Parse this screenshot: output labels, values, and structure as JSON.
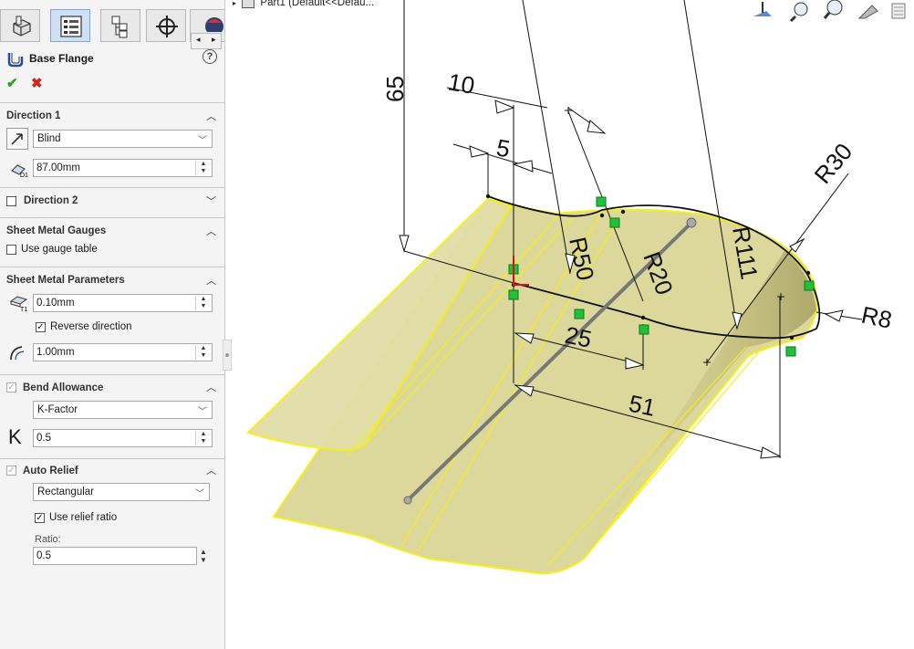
{
  "tabs": [
    {
      "name": "feature-manager",
      "icon": "feature-tree-icon"
    },
    {
      "name": "property-manager",
      "icon": "property-list-icon",
      "active": true
    },
    {
      "name": "configuration-manager",
      "icon": "configuration-icon"
    },
    {
      "name": "dimxpert-manager",
      "icon": "crosshair-icon"
    },
    {
      "name": "display-manager",
      "icon": "appearance-sphere-icon"
    }
  ],
  "feature": {
    "title": "Base Flange",
    "help": "?"
  },
  "direction1": {
    "header": "Direction 1",
    "end_condition": "Blind",
    "depth": "87.00mm"
  },
  "direction2": {
    "header": "Direction 2",
    "checked": false
  },
  "gauges": {
    "header": "Sheet Metal Gauges",
    "use_gauge_table": "Use gauge table"
  },
  "parameters": {
    "header": "Sheet Metal Parameters",
    "thickness": "0.10mm",
    "reverse_direction": "Reverse direction",
    "radius": "1.00mm"
  },
  "bend_allowance": {
    "header": "Bend Allowance",
    "type": "K-Factor",
    "k_label": "K",
    "k_value": "0.5"
  },
  "auto_relief": {
    "header": "Auto Relief",
    "type": "Rectangular",
    "use_ratio": "Use relief ratio",
    "ratio_label": "Ratio:",
    "ratio_value": "0.5"
  },
  "viewport": {
    "tree_text": "Part1  (Default<<Defau...",
    "dimensions": {
      "d65": "65",
      "d10": "10",
      "d5": "5",
      "r50": "R50",
      "r20": "R20",
      "r111": "R111",
      "r30": "R30",
      "r8": "R8",
      "d25": "25",
      "d51": "51"
    }
  },
  "colors": {
    "sheet_fill": "#dcd79a",
    "edge_yellow": "#f5ee1a",
    "relation_green": "#22c03a",
    "panel_bg": "#f4f4f4"
  }
}
